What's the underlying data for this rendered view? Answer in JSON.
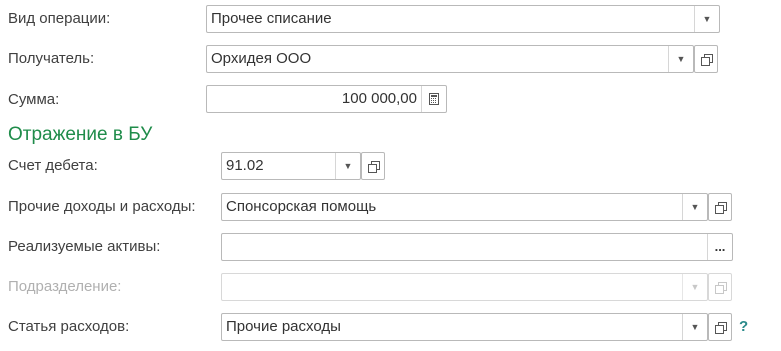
{
  "operation_type": {
    "label": "Вид операции:",
    "value": "Прочее списание"
  },
  "recipient": {
    "label": "Получатель:",
    "value": "Орхидея ООО"
  },
  "amount": {
    "label": "Сумма:",
    "value": "100 000,00"
  },
  "section": {
    "title": "Отражение в БУ"
  },
  "debit_account": {
    "label": "Счет дебета:",
    "value": "91.02"
  },
  "other_income_expenses": {
    "label": "Прочие доходы и расходы:",
    "value": "Спонсорская помощь"
  },
  "realized_assets": {
    "label": "Реализуемые активы:",
    "value": "",
    "button_label": "..."
  },
  "division": {
    "label": "Подразделение:",
    "value": "",
    "disabled": true
  },
  "expense_item": {
    "label": "Статья расходов:",
    "value": "Прочие расходы"
  },
  "help": {
    "label": "?"
  },
  "icons": {
    "dropdown": "chevron-down-icon",
    "open": "open-form-icon",
    "calculator": "calculator-icon",
    "select": "ellipsis-icon",
    "help": "help-icon"
  },
  "colors": {
    "section_title": "#1f8c4a",
    "help": "#2a8a8a",
    "disabled_text": "#b0b0b0"
  }
}
